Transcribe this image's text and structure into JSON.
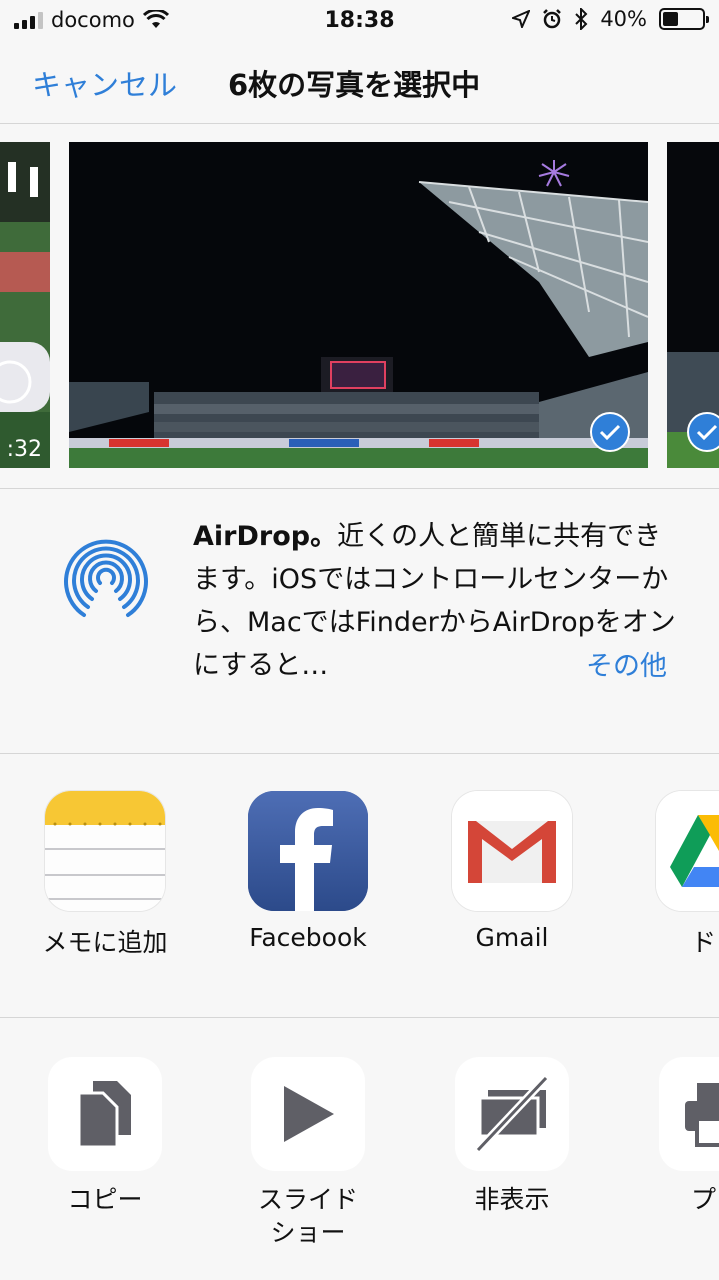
{
  "status_bar": {
    "carrier": "docomo",
    "time": "18:38",
    "battery": "40%",
    "battery_level": 0.4
  },
  "header": {
    "cancel_label": "キャンセル",
    "title": "6枚の写真を選択中"
  },
  "photos": {
    "left_video_duration": ":32"
  },
  "airdrop": {
    "title": "AirDrop。",
    "description": "近くの人と簡単に共有できます。iOSではコントロールセンターから、MacではFinderからAirDropをオンにすると…",
    "more_label": "その他"
  },
  "apps": [
    {
      "label": "メモに追加",
      "icon": "notes-icon"
    },
    {
      "label": "Facebook",
      "icon": "facebook-icon"
    },
    {
      "label": "Gmail",
      "icon": "gmail-icon"
    },
    {
      "label": "ドラ",
      "icon": "google-drive-icon"
    }
  ],
  "actions": [
    {
      "label": "コピー",
      "icon": "copy-icon"
    },
    {
      "label": "スライド\nショー",
      "icon": "slideshow-icon"
    },
    {
      "label": "非表示",
      "icon": "hide-icon"
    },
    {
      "label": "プリ",
      "icon": "print-icon"
    }
  ],
  "colors": {
    "accent": "#2f7fd8",
    "background": "#f7f7f7"
  }
}
